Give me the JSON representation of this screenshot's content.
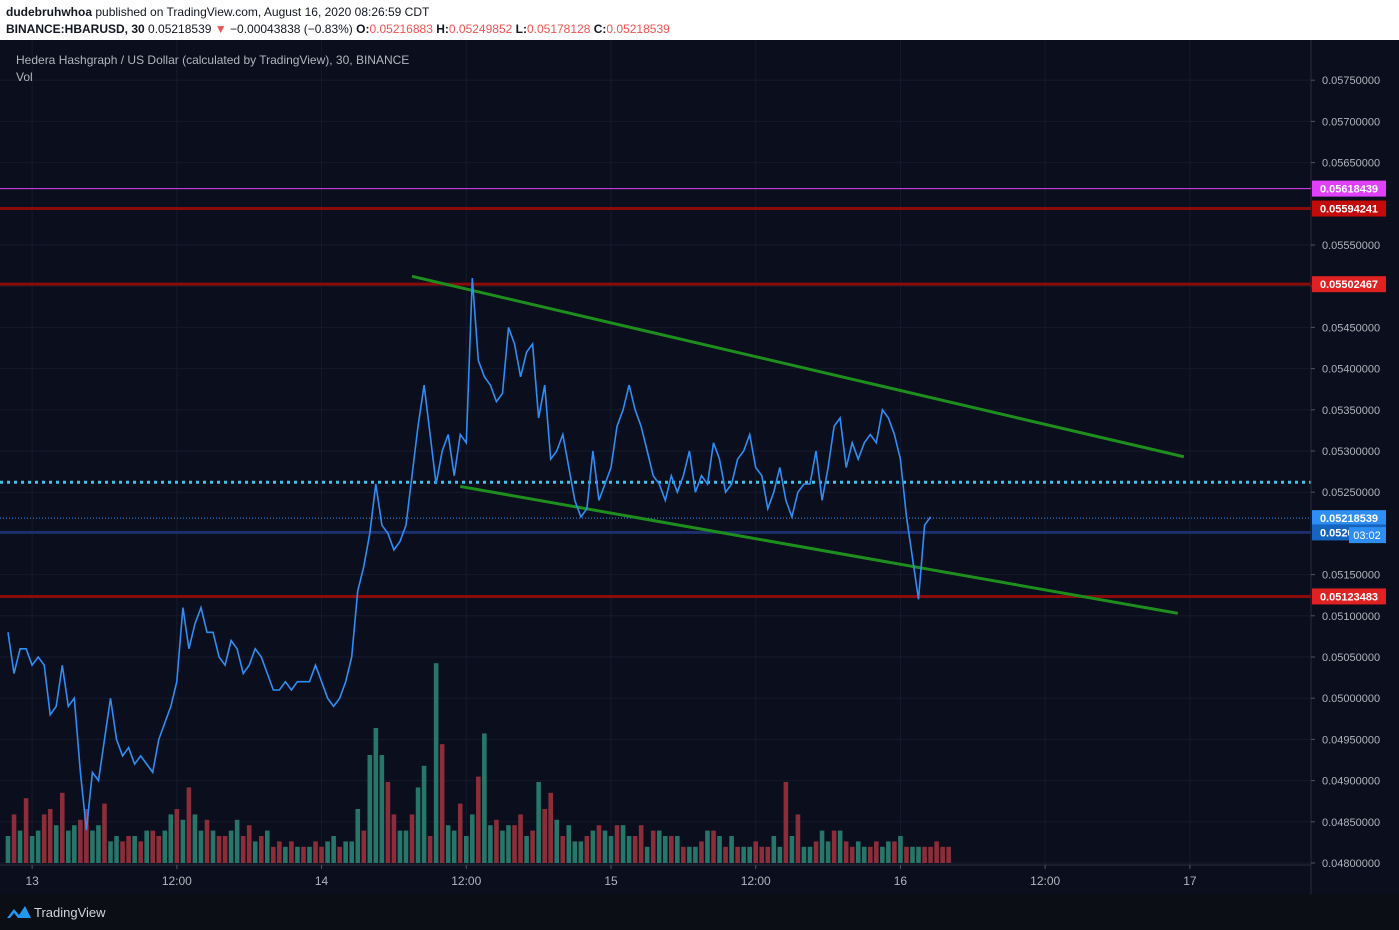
{
  "header": {
    "author": "dudebruhwhoa",
    "published_text": "published on TradingView.com, August 16, 2020 08:26:59 CDT",
    "symbol": "BINANCE:HBARUSD, 30",
    "last": "0.05218539",
    "change_arrow": "▼",
    "change": "−0.00043838 (−0.83%)",
    "o_label": "O:",
    "o": "0.05216883",
    "h_label": "H:",
    "h": "0.05249852",
    "l_label": "L:",
    "l": "0.05178128",
    "c_label": "C:",
    "c": "0.05218539"
  },
  "legend": {
    "title": "Hedera Hashgraph / US Dollar (calculated by TradingView), 30, BINANCE",
    "vol": "Vol"
  },
  "footer": {
    "brand": "TradingView"
  },
  "colors": {
    "background": "#0b0e1c",
    "price_line": "#2e8ef5",
    "trend": "#1e8f1e",
    "resistance": "#8b0a0a",
    "vol_up": "#26766a",
    "vol_down": "#8b2e3a",
    "magenta": "#e040fb",
    "cyan": "#3ec1e6",
    "blue_level": "#1b2f6b"
  },
  "chart_data": {
    "type": "line",
    "x_unit": "30-minute bars",
    "bar_minutes": 30,
    "time_start": "Aug 12, 2020 22:00",
    "y_range": [
      0.04775,
      0.05775
    ],
    "y_ticks": [
      "0.05750000",
      "0.05700000",
      "0.05650000",
      "0.05550000",
      "0.05500000",
      "0.05450000",
      "0.05400000",
      "0.05350000",
      "0.05300000",
      "0.05250000",
      "0.05150000",
      "0.05100000",
      "0.05050000",
      "0.05000000",
      "0.04950000",
      "0.04900000",
      "0.04850000",
      "0.04800000"
    ],
    "x_ticks": [
      {
        "label": "13",
        "time": "Aug 13 00:00"
      },
      {
        "label": "12:00",
        "time": "Aug 13 12:00"
      },
      {
        "label": "14",
        "time": "Aug 14 00:00"
      },
      {
        "label": "12:00",
        "time": "Aug 14 12:00"
      },
      {
        "label": "15",
        "time": "Aug 15 00:00"
      },
      {
        "label": "12:00",
        "time": "Aug 15 12:00"
      },
      {
        "label": "16",
        "time": "Aug 16 00:00"
      },
      {
        "label": "12:00",
        "time": "Aug 16 12:00"
      },
      {
        "label": "17",
        "time": "Aug 17 00:00"
      }
    ],
    "close": [
      0.0508,
      0.0503,
      0.0506,
      0.0506,
      0.0504,
      0.0505,
      0.0504,
      0.0498,
      0.0499,
      0.0504,
      0.0499,
      0.05,
      0.0491,
      0.0484,
      0.0491,
      0.049,
      0.0495,
      0.05,
      0.0495,
      0.0493,
      0.0494,
      0.0492,
      0.0493,
      0.0492,
      0.0491,
      0.0495,
      0.0497,
      0.0499,
      0.0502,
      0.0511,
      0.0506,
      0.0509,
      0.0511,
      0.0508,
      0.0508,
      0.0505,
      0.0504,
      0.0507,
      0.0506,
      0.0503,
      0.0504,
      0.0506,
      0.0505,
      0.0503,
      0.0501,
      0.0501,
      0.0502,
      0.0501,
      0.0502,
      0.0502,
      0.0502,
      0.0504,
      0.0502,
      0.05,
      0.0499,
      0.05,
      0.0502,
      0.0505,
      0.0513,
      0.0516,
      0.052,
      0.0526,
      0.0521,
      0.052,
      0.0518,
      0.0519,
      0.0521,
      0.0527,
      0.0533,
      0.0538,
      0.0532,
      0.0526,
      0.053,
      0.0532,
      0.0527,
      0.0532,
      0.0531,
      0.0551,
      0.0541,
      0.0539,
      0.0538,
      0.0536,
      0.0537,
      0.0545,
      0.0543,
      0.0539,
      0.0542,
      0.0543,
      0.0534,
      0.0538,
      0.0529,
      0.053,
      0.0532,
      0.0528,
      0.0524,
      0.0522,
      0.0523,
      0.053,
      0.0524,
      0.0526,
      0.0528,
      0.0533,
      0.0535,
      0.0538,
      0.0535,
      0.0533,
      0.053,
      0.0527,
      0.0526,
      0.0524,
      0.0527,
      0.0525,
      0.0527,
      0.053,
      0.0525,
      0.0527,
      0.0526,
      0.0531,
      0.0529,
      0.0525,
      0.0526,
      0.0529,
      0.053,
      0.0532,
      0.0528,
      0.0527,
      0.0523,
      0.0525,
      0.0528,
      0.0524,
      0.0522,
      0.0525,
      0.0526,
      0.0526,
      0.053,
      0.0524,
      0.0528,
      0.0533,
      0.0534,
      0.0528,
      0.0531,
      0.0529,
      0.0531,
      0.0532,
      0.0531,
      0.0535,
      0.0534,
      0.0532,
      0.0529,
      0.0522,
      0.0517,
      0.0512,
      0.0521,
      0.0522
    ],
    "volume": [
      5,
      9,
      6,
      12,
      5,
      6,
      9,
      10,
      7,
      13,
      6,
      7,
      8,
      10,
      6,
      7,
      11,
      4,
      5,
      4,
      5,
      5,
      4,
      6,
      6,
      5,
      6,
      9,
      10,
      8,
      14,
      9,
      6,
      8,
      6,
      5,
      5,
      6,
      8,
      5,
      7,
      4,
      5,
      6,
      3,
      4,
      3,
      4,
      3,
      3,
      3,
      4,
      3,
      4,
      5,
      3,
      4,
      4,
      10,
      6,
      20,
      25,
      20,
      15,
      9,
      6,
      6,
      9,
      14,
      18,
      5,
      37,
      22,
      7,
      6,
      11,
      5,
      9,
      16,
      24,
      7,
      8,
      6,
      7,
      7,
      9,
      5,
      6,
      15,
      10,
      13,
      8,
      5,
      7,
      4,
      4,
      5,
      6,
      7,
      6,
      5,
      7,
      7,
      5,
      5,
      7,
      3,
      6,
      6,
      5,
      5,
      5,
      3,
      3,
      3,
      4,
      6,
      6,
      5,
      3,
      5,
      3,
      3,
      3,
      4,
      3,
      3,
      5,
      3,
      15,
      5,
      9,
      3,
      3,
      4,
      6,
      4,
      6,
      6,
      4,
      3,
      4,
      3,
      3,
      4,
      3,
      4,
      4,
      5,
      3,
      3,
      3,
      3,
      3,
      4,
      3,
      3
    ],
    "volume_direction": [
      1,
      -1,
      1,
      -1,
      1,
      1,
      -1,
      -1,
      1,
      -1,
      1,
      1,
      -1,
      -1,
      1,
      1,
      -1,
      1,
      1,
      -1,
      -1,
      1,
      -1,
      1,
      -1,
      -1,
      1,
      1,
      -1,
      1,
      -1,
      1,
      1,
      -1,
      1,
      -1,
      -1,
      1,
      1,
      -1,
      -1,
      1,
      -1,
      1,
      -1,
      -1,
      1,
      -1,
      1,
      -1,
      1,
      -1,
      -1,
      1,
      1,
      -1,
      1,
      1,
      1,
      -1,
      1,
      1,
      1,
      -1,
      -1,
      1,
      1,
      -1,
      1,
      1,
      -1,
      1,
      -1,
      1,
      1,
      -1,
      1,
      1,
      -1,
      1,
      1,
      -1,
      1,
      1,
      -1,
      -1,
      1,
      -1,
      1,
      -1,
      -1,
      1,
      -1,
      1,
      1,
      1,
      -1,
      1,
      -1,
      1,
      1,
      -1,
      1,
      1,
      -1,
      -1,
      1,
      -1,
      1,
      1,
      -1,
      1,
      -1,
      1,
      1,
      -1,
      1,
      -1,
      1,
      -1,
      1,
      -1,
      1,
      1,
      -1,
      -1,
      -1,
      1,
      1,
      -1,
      1,
      -1,
      1,
      1,
      -1,
      1,
      1,
      -1,
      1,
      -1,
      -1,
      1,
      1,
      -1,
      -1,
      1,
      1,
      -1,
      1,
      -1,
      1,
      1
    ],
    "levels": [
      {
        "price": 0.05618439,
        "label": "0.05618439",
        "color": "#e040fb",
        "label_bg": "#e040fb",
        "style": "thin"
      },
      {
        "price": 0.05594241,
        "label": "0.05594241",
        "color": "#8b0a0a",
        "label_bg": "#c40b0b",
        "style": "solid"
      },
      {
        "price": 0.05502467,
        "label": "0.05502467",
        "color": "#8b0a0a",
        "label_bg": "#e02121",
        "style": "solid"
      },
      {
        "price": 0.05262,
        "label": "",
        "color": "#3ec1e6",
        "label_bg": "",
        "style": "dotted"
      },
      {
        "price": 0.05218539,
        "label": "0.05218539",
        "color": "#2e8ef5",
        "label_bg": "#2e8ef5",
        "style": "dotted-thin"
      },
      {
        "price": 0.05201203,
        "label": "0.05201203",
        "color": "#1b2f6b",
        "label_bg": "#1565c0",
        "style": "solid"
      },
      {
        "price": 0.05123483,
        "label": "0.05123483",
        "color": "#8b0a0a",
        "label_bg": "#e02121",
        "style": "solid"
      }
    ],
    "countdown": "03:02",
    "trend_lines": [
      {
        "from": [
          "Aug 14 07:30",
          0.05512
        ],
        "to": [
          "Aug 16 23:30",
          0.05293
        ]
      },
      {
        "from": [
          "Aug 14 11:30",
          0.05257
        ],
        "to": [
          "Aug 16 23:00",
          0.05103
        ]
      }
    ]
  }
}
